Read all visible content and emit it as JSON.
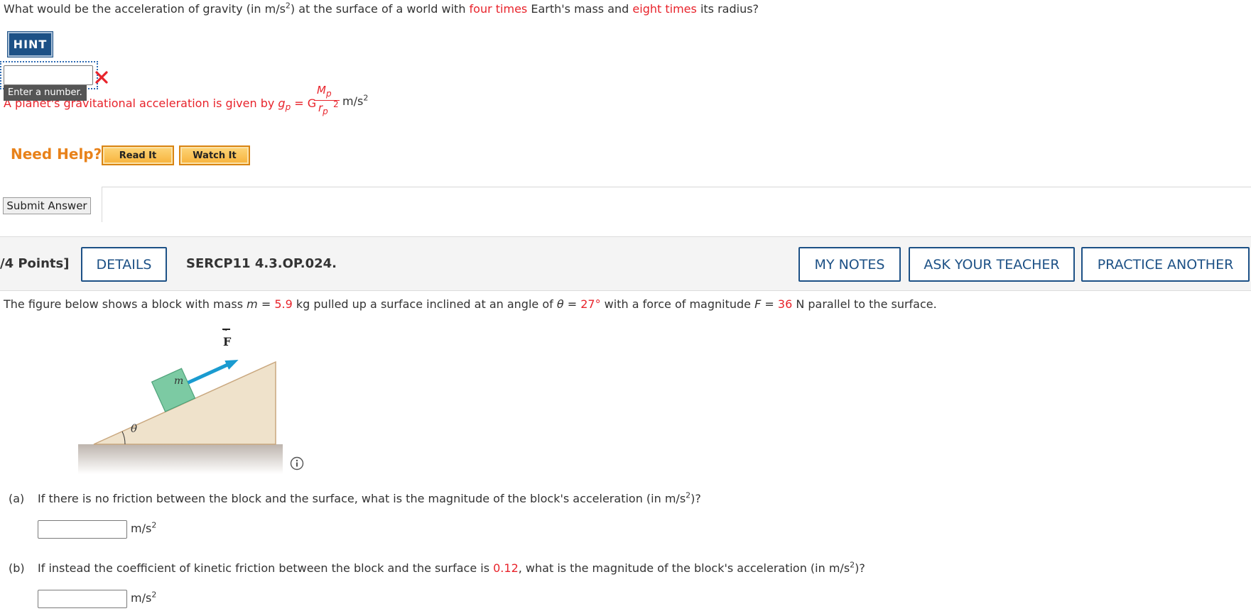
{
  "prev_question": {
    "text_a": "What would be the acceleration of gravity (in m/s",
    "text_b": ") at the surface of a world with ",
    "mass_factor": "four times",
    "text_c": " Earth's mass and ",
    "radius_factor": "eight times",
    "text_d": " its radius?",
    "sup": "2",
    "hint_label": "HINT",
    "tooltip": "Enter a number.",
    "feedback_text": "A planet's gravitational acceleration is given by ",
    "formula": {
      "lhs": "g",
      "lhs_sub": "p",
      "eq": " = G",
      "num": "M",
      "num_sub": "p",
      "den": "r",
      "den_sub": "p",
      "den_sup": "2",
      "unit": "m/s",
      "unit_sup": "2"
    },
    "need_help": "Need Help?",
    "read_it": "Read It",
    "watch_it": "Watch It",
    "submit": "Submit Answer"
  },
  "question": {
    "points": "/4 Points]",
    "details": "DETAILS",
    "code": "SERCP11 4.3.OP.024.",
    "my_notes": "MY NOTES",
    "ask_teacher": "ASK YOUR TEACHER",
    "practice": "PRACTICE ANOTHER",
    "intro_a": "The figure below shows a block with mass ",
    "m_sym": "m",
    "eq1": " = ",
    "mass_value": "5.9",
    "intro_b": " kg pulled up a surface inclined at an angle of ",
    "theta_sym": "θ",
    "eq2": " = ",
    "angle_value": "27°",
    "intro_c": " with a force of magnitude ",
    "f_sym": "F",
    "eq3": " = ",
    "force_value": "36",
    "intro_d": " N parallel to the surface.",
    "figure": {
      "force_label": "F",
      "mass_label": "m",
      "angle_label": "θ"
    },
    "part_a": {
      "label": "(a)",
      "text": "If there is no friction between the block and the surface, what is the magnitude of the block's acceleration (in m/s",
      "sup": "2",
      "tail": ")?",
      "unit": "m/s",
      "unit_sup": "2"
    },
    "part_b": {
      "label": "(b)",
      "text_a": "If instead the coefficient of kinetic friction between the block and the surface is ",
      "mu": "0.12",
      "text_b": ", what is the magnitude of the block's acceleration (in m/s",
      "sup": "2",
      "tail": ")?",
      "unit": "m/s",
      "unit_sup": "2"
    }
  }
}
